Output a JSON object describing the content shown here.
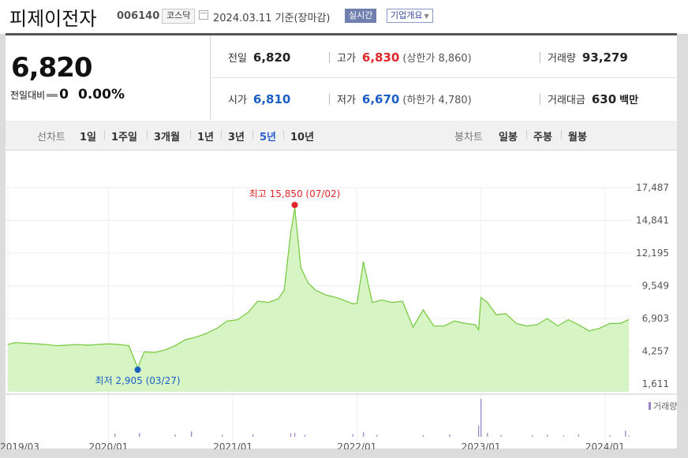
{
  "header": {
    "stock_name": "피제이전자",
    "stock_code": "006140",
    "market": "코스닥",
    "date_text": "2024.03.11  기준(장마감)",
    "realtime_label": "실시간",
    "company_label": "기업개요"
  },
  "price": {
    "current": "6,820",
    "prev_label": "전일대비",
    "change": "0",
    "change_pct": "0.00%"
  },
  "stats": {
    "prev_close_label": "전일",
    "prev_close": "6,820",
    "high_label": "고가",
    "high": "6,830",
    "upper_limit": "(상한가 8,860)",
    "volume_label": "거래량",
    "volume": "93,279",
    "open_label": "시가",
    "open": "6,810",
    "low_label": "저가",
    "low": "6,670",
    "lower_limit": "(하한가 4,780)",
    "amount_label": "거래대금",
    "amount": "630",
    "amount_unit": "백만"
  },
  "tabs": {
    "line_label": "선차트",
    "line_periods": [
      "1일",
      "1주일",
      "3개월",
      "1년",
      "3년",
      "5년",
      "10년"
    ],
    "active_period": "5년",
    "candle_label": "봉차트",
    "candle_periods": [
      "일봉",
      "주봉",
      "월봉"
    ]
  },
  "colors": {
    "accent_red": "#e0272b",
    "accent_blue": "#1a5fc6",
    "line": "#7acb45",
    "fill": "#d7f5c4",
    "volume": "#9b84c9"
  },
  "chart_data": {
    "type": "area",
    "y_ticks": [
      "17,487",
      "14,841",
      "12,195",
      "9,549",
      "6,903",
      "4,257",
      "1,611"
    ],
    "x_ticks": [
      "2019/03",
      "2020/01",
      "2021/01",
      "2022/01",
      "2023/01",
      "2024/01"
    ],
    "ylim": [
      1611,
      17487
    ],
    "max_annotation": "최고 15,850 (07/02)",
    "min_annotation": "최저 2,905 (03/27)",
    "volume_label": "거래량",
    "series": [
      {
        "x": [
          "2019-03-11",
          "2019-04-01",
          "2019-05-01",
          "2019-06-01",
          "2019-07-01",
          "2019-08-01",
          "2019-09-01",
          "2019-10-01",
          "2019-11-01",
          "2019-12-01",
          "2020-01-01",
          "2020-02-01",
          "2020-03-01",
          "2020-03-27",
          "2020-04-15",
          "2020-05-15",
          "2020-06-15",
          "2020-07-15",
          "2020-08-15",
          "2020-09-15",
          "2020-10-15",
          "2020-11-15",
          "2020-12-15",
          "2021-01-15",
          "2021-02-15",
          "2021-03-15",
          "2021-04-15",
          "2021-05-15",
          "2021-06-01",
          "2021-06-20",
          "2021-07-02",
          "2021-07-20",
          "2021-08-10",
          "2021-09-01",
          "2021-10-01",
          "2021-11-01",
          "2021-12-01",
          "2021-12-20",
          "2022-01-01",
          "2022-01-20",
          "2022-02-15",
          "2022-03-15",
          "2022-04-15",
          "2022-05-15",
          "2022-06-15",
          "2022-07-15",
          "2022-08-15",
          "2022-09-15",
          "2022-10-15",
          "2022-11-15",
          "2022-12-15",
          "2022-12-25",
          "2023-01-01",
          "2023-01-20",
          "2023-02-15",
          "2023-03-15",
          "2023-04-15",
          "2023-05-15",
          "2023-06-15",
          "2023-07-15",
          "2023-08-15",
          "2023-09-15",
          "2023-10-15",
          "2023-11-15",
          "2023-12-15",
          "2024-01-15",
          "2024-02-15",
          "2024-03-11"
        ],
        "y": [
          4800,
          4950,
          4900,
          4850,
          4800,
          4700,
          4750,
          4800,
          4750,
          4800,
          4850,
          4800,
          4700,
          2905,
          4200,
          4150,
          4350,
          4700,
          5200,
          5400,
          5700,
          6100,
          6700,
          6800,
          7400,
          8300,
          8200,
          8500,
          9200,
          13800,
          15850,
          11000,
          9800,
          9200,
          8800,
          8600,
          8300,
          8100,
          8100,
          11500,
          8200,
          8400,
          8200,
          8300,
          6200,
          7600,
          6300,
          6300,
          6700,
          6500,
          6400,
          6000,
          8600,
          8200,
          7200,
          7300,
          6500,
          6300,
          6400,
          6900,
          6300,
          6800,
          6400,
          5900,
          6100,
          6500,
          6500,
          6820
        ]
      }
    ],
    "volume": {
      "x": [
        "2020-01-20",
        "2020-04-01",
        "2020-07-15",
        "2020-09-01",
        "2020-12-01",
        "2021-03-01",
        "2021-06-20",
        "2021-07-02",
        "2021-08-01",
        "2021-12-20",
        "2022-01-20",
        "2022-03-01",
        "2022-07-15",
        "2022-10-01",
        "2022-12-25",
        "2023-01-01",
        "2023-01-20",
        "2023-03-01",
        "2023-06-01",
        "2023-07-15",
        "2023-09-01",
        "2023-10-15",
        "2024-01-15",
        "2024-03-01",
        "2024-03-11"
      ],
      "y": [
        8,
        10,
        6,
        14,
        5,
        6,
        9,
        10,
        5,
        7,
        12,
        5,
        4,
        6,
        30,
        100,
        10,
        5,
        4,
        5,
        3,
        6,
        4,
        16,
        3
      ]
    }
  }
}
